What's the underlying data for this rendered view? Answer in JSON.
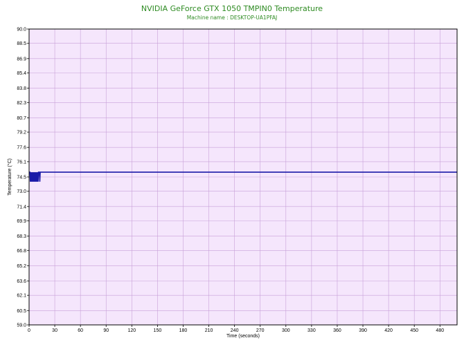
{
  "chart_data": {
    "type": "line",
    "title": "NVIDIA GeForce GTX 1050 TMPIN0 Temperature",
    "subtitle": "Machine name : DESKTOP-UA1PFAJ",
    "xlabel": "Time (seconds)",
    "ylabel": "Temperature (°C)",
    "xlim": [
      0,
      500
    ],
    "ylim": [
      59.0,
      90.0
    ],
    "grid": true,
    "legend": "none",
    "x_ticks": [
      0,
      30,
      60,
      90,
      120,
      150,
      180,
      210,
      240,
      270,
      300,
      330,
      360,
      390,
      420,
      450,
      480
    ],
    "y_ticks": [
      "90.0",
      "88.5",
      "86.9",
      "85.4",
      "83.8",
      "82.3",
      "80.7",
      "79.2",
      "77.6",
      "76.1",
      "74.5",
      "73.0",
      "71.4",
      "69.9",
      "68.3",
      "66.8",
      "65.2",
      "63.6",
      "62.1",
      "60.5",
      "59.0"
    ],
    "colors": {
      "line": "#1a1aa8",
      "plot_background": "#f5e6fc",
      "grid": "#c8a0d8",
      "title": "#2e8b22"
    },
    "series": [
      {
        "x": [
          0,
          1,
          1.5,
          2,
          2.5,
          3,
          3.5,
          4,
          4.5,
          5,
          5.5,
          6,
          6.5,
          7,
          7.5,
          8,
          8.5,
          9,
          9.5,
          10,
          10.5,
          11,
          11.5,
          12,
          12.5,
          13,
          13.5,
          14,
          100,
          200,
          300,
          400,
          500
        ],
        "y": [
          75,
          75,
          74,
          75,
          74,
          75,
          74,
          75,
          74,
          75,
          74,
          75,
          74,
          75,
          74,
          75,
          74,
          75,
          74,
          75,
          74,
          75,
          75,
          75,
          74,
          75,
          75,
          75,
          75,
          75,
          75,
          75,
          75
        ]
      }
    ]
  }
}
